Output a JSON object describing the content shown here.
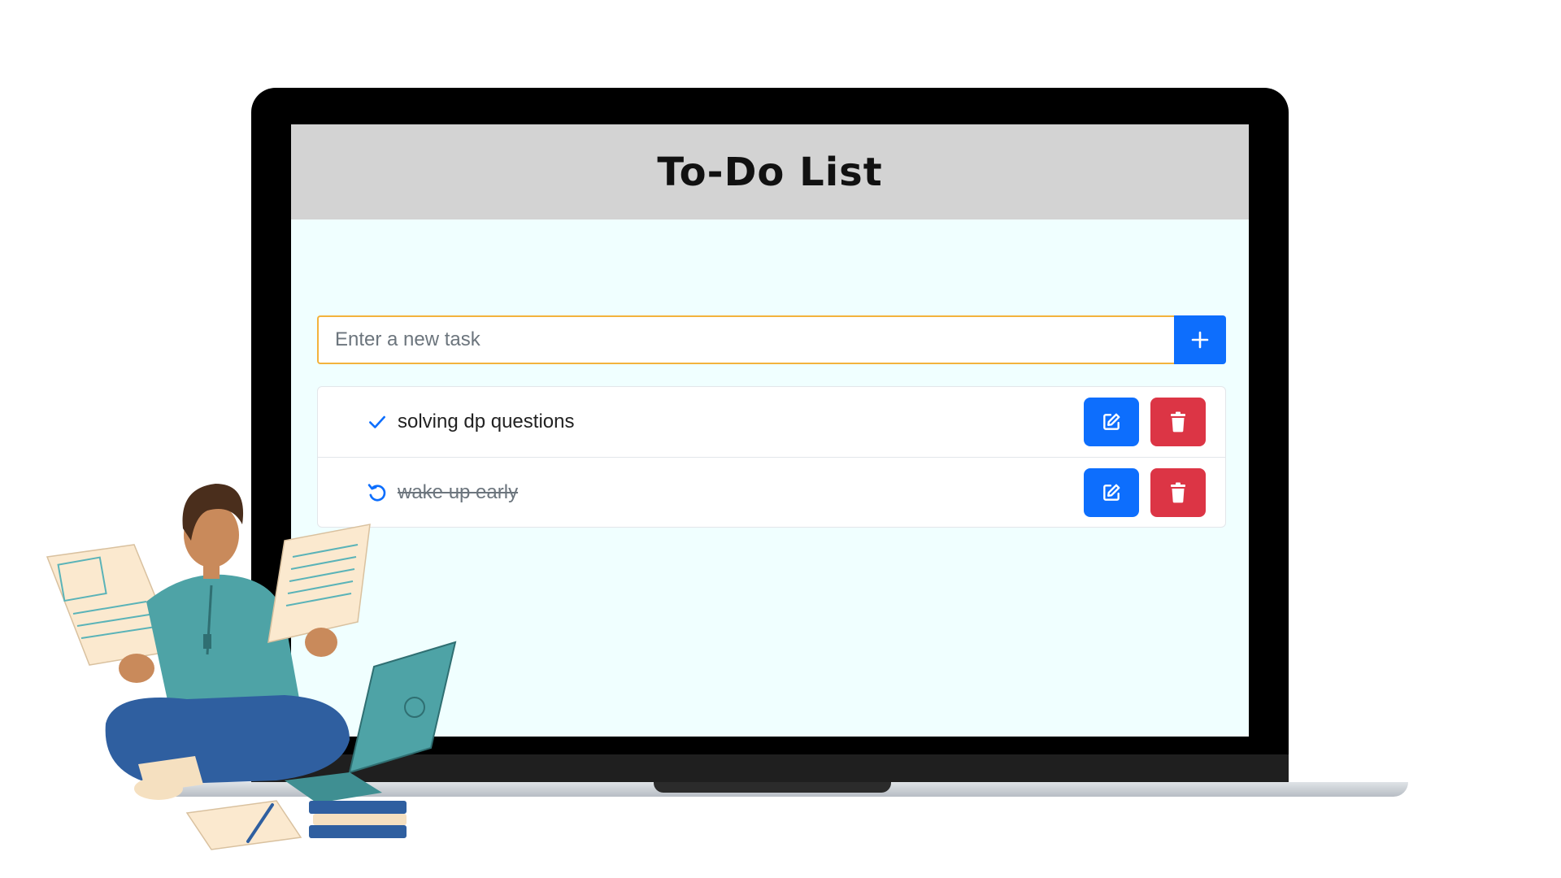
{
  "app": {
    "title": "To-Do List"
  },
  "form": {
    "input_placeholder": "Enter a new task",
    "input_value": "",
    "add_icon": "plus-icon"
  },
  "tasks": [
    {
      "text": "solving dp questions",
      "completed": false,
      "status_icon": "check-icon",
      "edit_icon": "edit-icon",
      "delete_icon": "trash-icon"
    },
    {
      "text": "wake up early",
      "completed": true,
      "status_icon": "undo-icon",
      "edit_icon": "edit-icon",
      "delete_icon": "trash-icon"
    }
  ],
  "colors": {
    "header_bg": "#d3d3d3",
    "screen_bg": "#f0ffff",
    "primary": "#0d6efd",
    "danger": "#dc3545",
    "input_border": "#f3b33d"
  }
}
